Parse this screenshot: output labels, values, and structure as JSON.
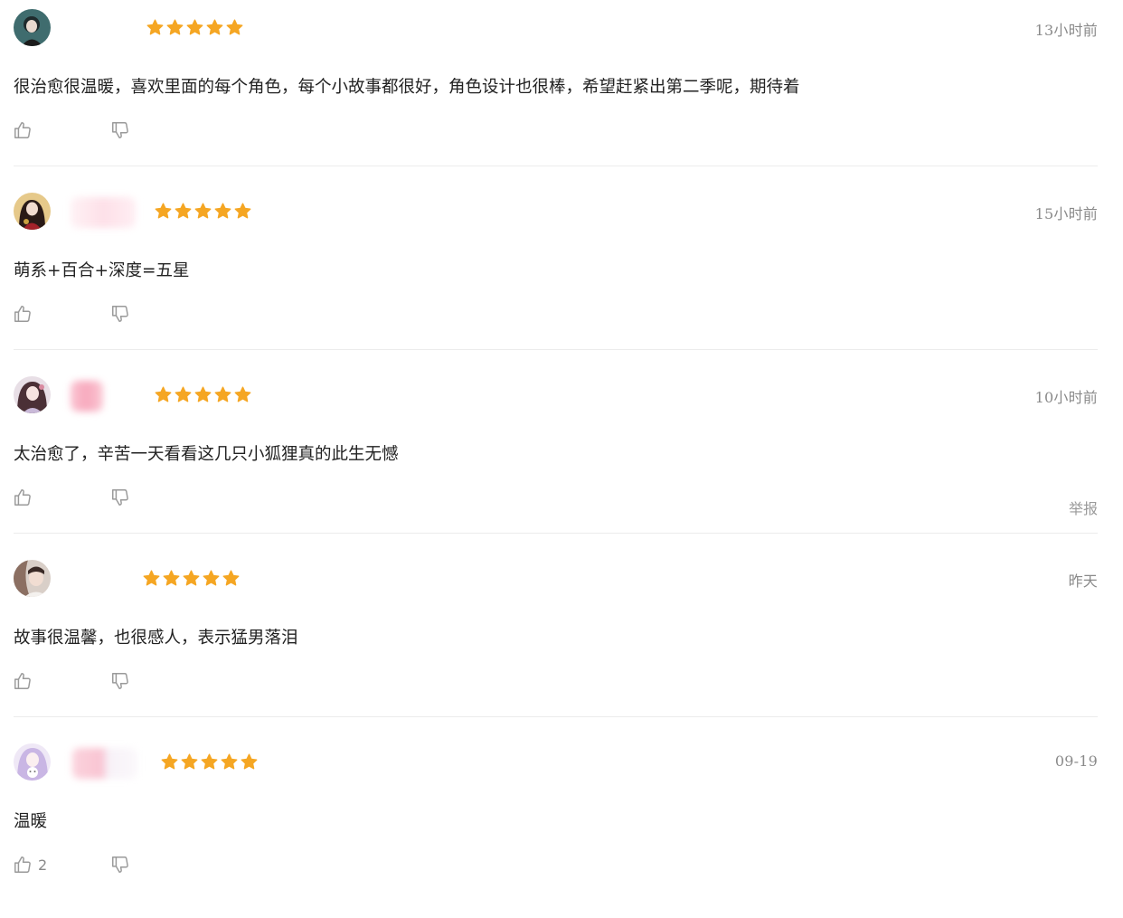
{
  "colors": {
    "star": "#f5a623",
    "timestamp": "#8a8a8a",
    "icon": "#9a9a9a",
    "divider": "#ececec"
  },
  "icons": {
    "rating": "star-icon",
    "like": "thumbs-up-icon",
    "dislike": "thumbs-down-icon"
  },
  "reviews": [
    {
      "rating": 5,
      "time": "13小时前",
      "text": "很治愈很温暖，喜欢里面的每个角色，每个小故事都很好，角色设计也很棒，希望赶紧出第二季呢，期待着",
      "likes": "",
      "report": ""
    },
    {
      "rating": 5,
      "time": "15小时前",
      "text": "萌系+百合+深度=五星",
      "likes": "",
      "report": ""
    },
    {
      "rating": 5,
      "time": "10小时前",
      "text": "太治愈了，辛苦一天看看这几只小狐狸真的此生无憾",
      "likes": "",
      "report": "举报"
    },
    {
      "rating": 5,
      "time": "昨天",
      "text": "故事很温馨，也很感人，表示猛男落泪",
      "likes": "",
      "report": ""
    },
    {
      "rating": 5,
      "time": "09-19",
      "text": "温暖",
      "likes": "2",
      "report": ""
    }
  ]
}
